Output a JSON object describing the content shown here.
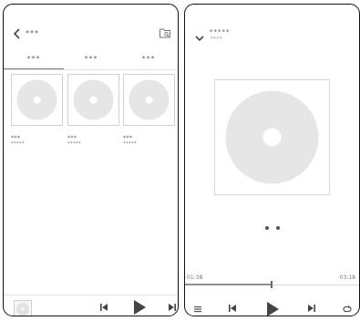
{
  "left_screen": {
    "header": {
      "title": "***"
    },
    "tabs": [
      {
        "label": "***",
        "active": true
      },
      {
        "label": "***",
        "active": false
      },
      {
        "label": "***",
        "active": false
      }
    ],
    "albums": [
      {
        "name": "***",
        "artist": "*****"
      },
      {
        "name": "***",
        "artist": "*****"
      },
      {
        "name": "***",
        "artist": "*****"
      }
    ],
    "bottom_bar": {
      "icons": [
        "album-thumbnail",
        "skip-previous-icon",
        "play-icon",
        "skip-next-icon"
      ]
    }
  },
  "right_screen": {
    "track_title": "*****",
    "track_artist": "****",
    "elapsed_time": "01:38",
    "total_time": "03:18",
    "progress": 0.49,
    "controls": [
      "queue-icon",
      "skip-previous-icon",
      "play-icon",
      "skip-next-icon",
      "repeat-icon"
    ]
  },
  "colors": {
    "frame": "#111111",
    "disc": "#e6e6e6",
    "icon": "#444444"
  }
}
